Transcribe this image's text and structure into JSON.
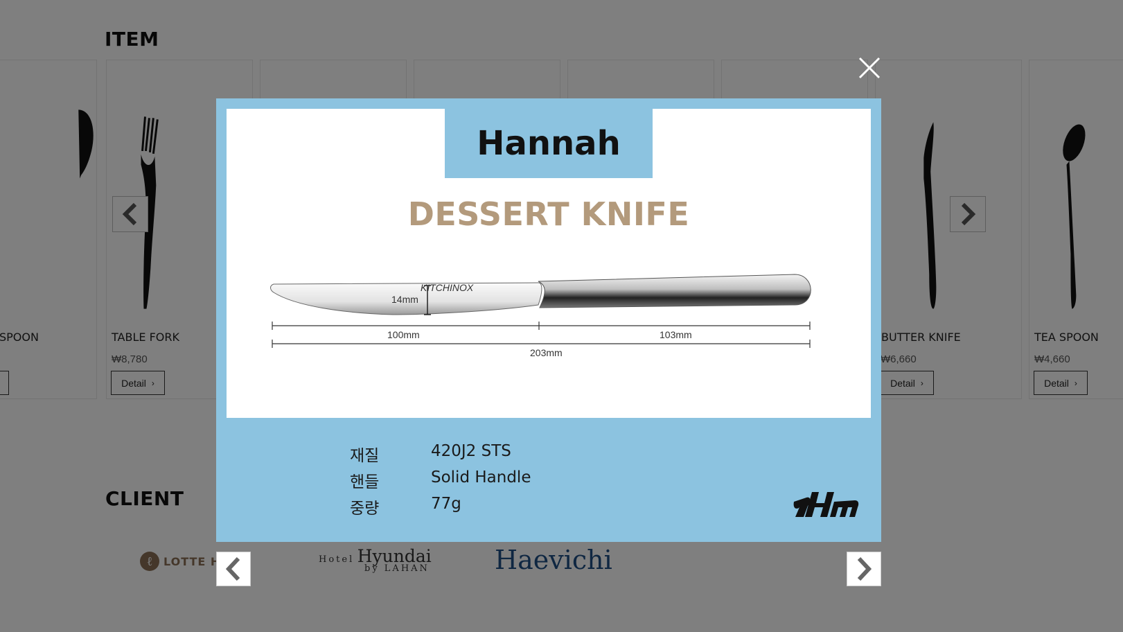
{
  "page": {
    "item_title": "ITEM",
    "client_title": "CLIENT",
    "items": [
      {
        "name": "SPOON",
        "price": "",
        "detail": "Detail"
      },
      {
        "name": "TABLE FORK",
        "price": "₩8,780",
        "detail": "Detail"
      },
      {
        "name": "BUTTER KNIFE",
        "price": "₩6,660",
        "detail": "Detail"
      },
      {
        "name": "TEA SPOON",
        "price": "₩4,660",
        "detail": "Detail"
      }
    ],
    "clients": {
      "lotte": "LOTTE H",
      "hyundai_top": "Hotel",
      "hyundai_main": "Hyundai",
      "hyundai_sub": "by LAHAN",
      "haevichi": "Haevichi"
    }
  },
  "modal": {
    "brand": "Hannah",
    "product": "DESSERT KNIFE",
    "dimensions": {
      "blade_width": "14mm",
      "blade_length": "100mm",
      "handle_length": "103mm",
      "total_length": "203mm",
      "engraving": "KITCHINOX"
    },
    "specs": [
      {
        "label": "재질",
        "value": "420J2 STS"
      },
      {
        "label": "핸들",
        "value": "Solid Handle"
      },
      {
        "label": "중량",
        "value": "77g"
      }
    ],
    "logo": "DHM"
  },
  "colors": {
    "modal_bg": "#8cc3e0",
    "product_title": "#b39a7c",
    "overlay": "rgba(0,0,0,0.5)"
  }
}
